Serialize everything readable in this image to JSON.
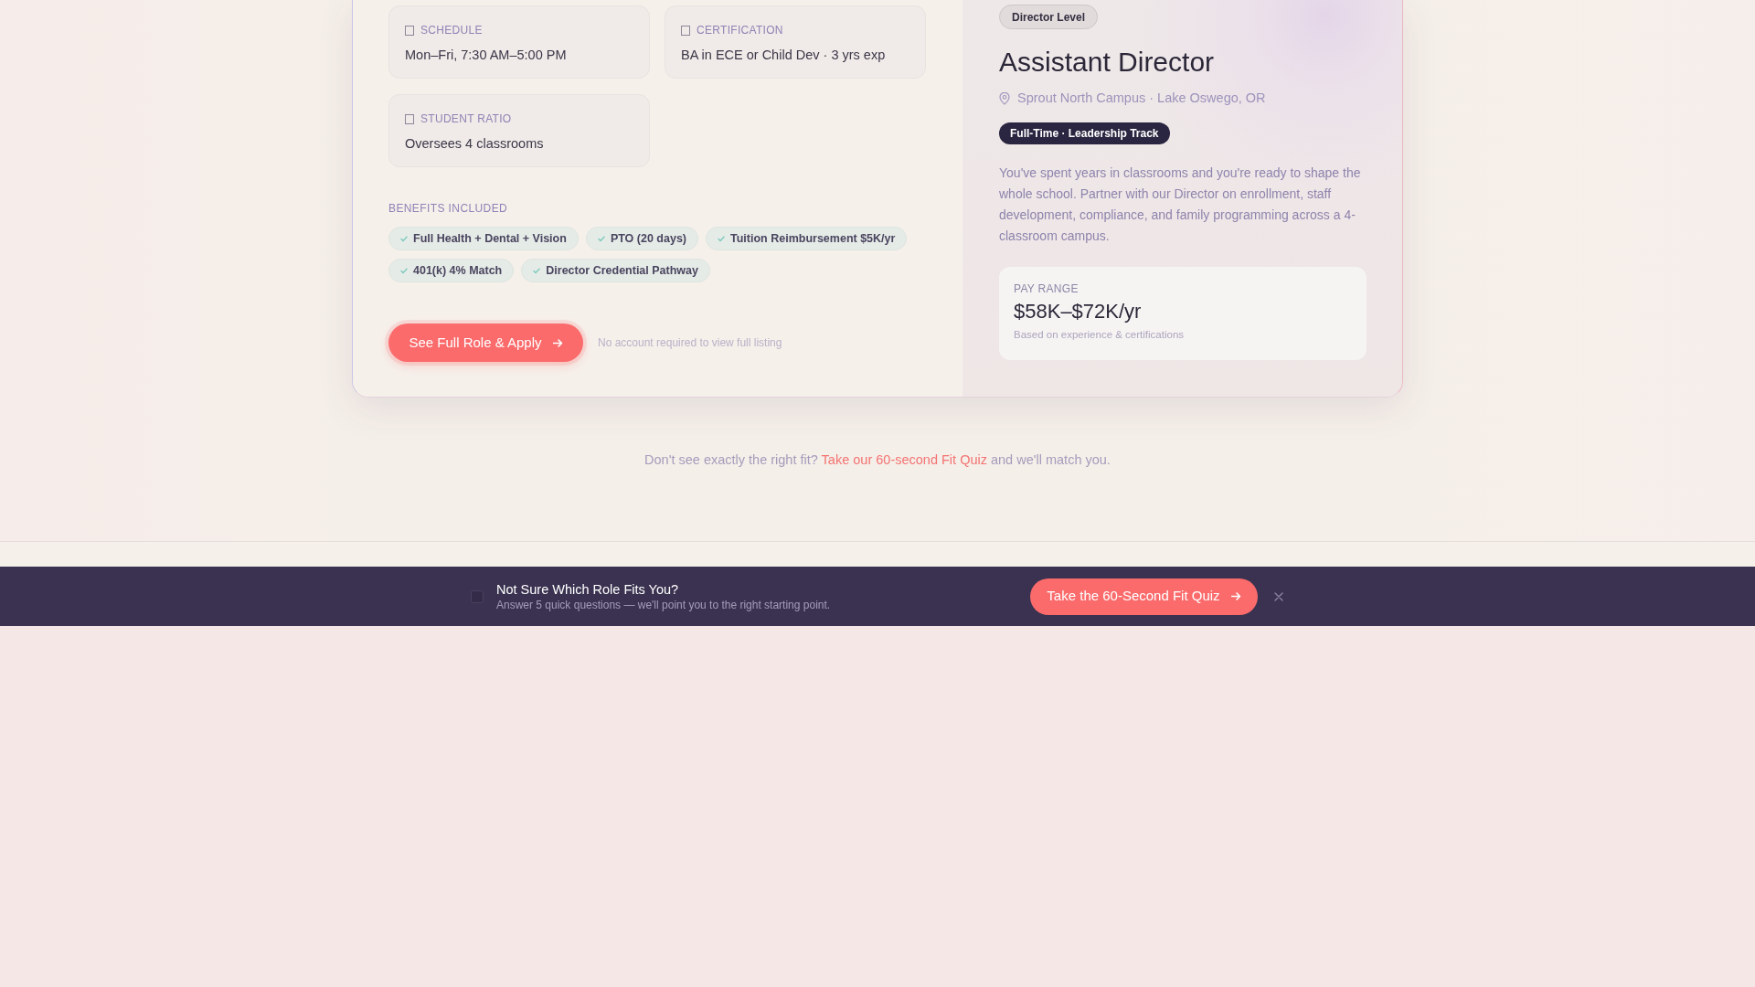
{
  "job_card": {
    "details": [
      {
        "label": "SCHEDULE",
        "value": "Mon–Fri, 7:30 AM–5:00 PM"
      },
      {
        "label": "CERTIFICATION",
        "value": "BA in ECE or Child Dev · 3 yrs exp"
      },
      {
        "label": "STUDENT RATIO",
        "value": "Oversees 4 classrooms"
      }
    ],
    "benefits_title": "BENEFITS INCLUDED",
    "benefits": [
      "Full Health + Dental + Vision",
      "PTO (20 days)",
      "Tuition Reimbursement $5K/yr",
      "401(k) 4% Match",
      "Director Credential Pathway"
    ],
    "apply_button": "See Full Role & Apply",
    "apply_note": "No account required to view full listing",
    "level_badge": "Director Level",
    "title": "Assistant Director",
    "location": "Sprout North Campus · Lake Oswego, OR",
    "employment_tag": "Full-Time · Leadership Track",
    "description": "You've spent years in classrooms and you're ready to shape the whole school. Partner with our Director on enrollment, staff development, compliance, and family programming across a 4-classroom campus.",
    "pay": {
      "label": "PAY RANGE",
      "amount": "$58K–$72K/yr",
      "note": "Based on experience & certifications"
    }
  },
  "fit_prompt": {
    "text_before": "Don't see exactly the right fit?",
    "link": "Take our 60-second Fit Quiz",
    "text_after": "and we'll match you."
  },
  "quiz_banner": {
    "title": "Not Sure Which Role Fits You?",
    "subtitle": "Answer 5 quick questions — we'll point you to the right starting point.",
    "button": "Take the 60-Second Fit Quiz"
  }
}
